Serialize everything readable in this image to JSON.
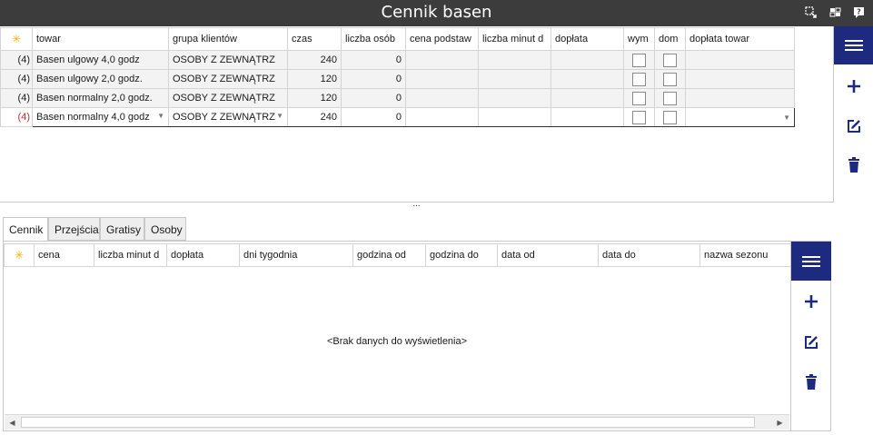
{
  "window": {
    "title": "Cennik basen"
  },
  "top_grid": {
    "columns": [
      "towar",
      "grupa klientów",
      "czas",
      "liczba osób",
      "cena podstaw",
      "liczba minut d",
      "dopłata",
      "wym",
      "dom",
      "dopłata towar"
    ],
    "rows": [
      {
        "hdr": "(4)",
        "towar": "Basen ulgowy 4,0 godz",
        "grupa": "OSOBY Z ZEWNĄTRZ",
        "czas": "240",
        "osob": "0"
      },
      {
        "hdr": "(4)",
        "towar": "Basen ulgowy 2,0 godz.",
        "grupa": "OSOBY Z ZEWNĄTRZ",
        "czas": "120",
        "osob": "0"
      },
      {
        "hdr": "(4)",
        "towar": "Basen normalny 2,0 godz.",
        "grupa": "OSOBY Z ZEWNĄTRZ",
        "czas": "120",
        "osob": "0"
      },
      {
        "hdr": "(4)",
        "towar": "Basen normalny 4,0 godz",
        "grupa": "OSOBY Z ZEWNĄTRZ",
        "czas": "240",
        "osob": "0"
      }
    ]
  },
  "splitter": {
    "glyph": "..."
  },
  "tabs": [
    "Cennik",
    "Przejścia",
    "Gratisy",
    "Osoby"
  ],
  "bottom_grid": {
    "columns": [
      "cena",
      "liczba minut d",
      "dopłata",
      "dni tygodnia",
      "godzina od",
      "godzina do",
      "data od",
      "data do",
      "nazwa sezonu"
    ],
    "empty_text": "<Brak danych do wyświetlenia>"
  },
  "icons": {
    "new_row": "asterisk-icon",
    "menu": "hamburger-menu-icon",
    "add": "plus-icon",
    "edit": "edit-icon",
    "delete": "trash-icon"
  },
  "colors": {
    "titlebar": "#3c3c3c",
    "accent": "#1e2a80",
    "current_row_marker": "#cc2a2a",
    "new_row_star": "#f1b400"
  }
}
